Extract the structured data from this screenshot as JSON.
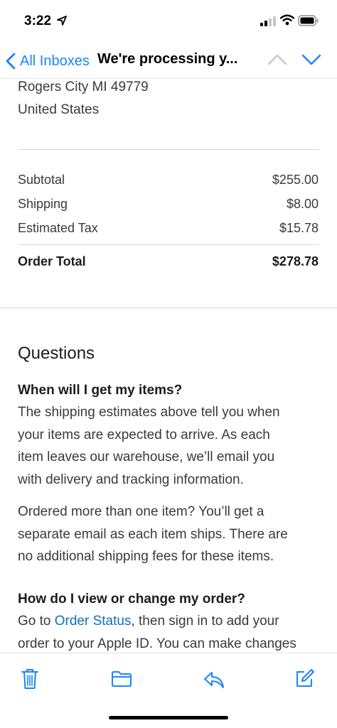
{
  "status_bar": {
    "time": "3:22"
  },
  "nav": {
    "back_label": "All Inboxes",
    "subject": "We're processing y..."
  },
  "address": {
    "line1": "Rogers City MI 49779",
    "line2": "United States"
  },
  "summary": {
    "rows": [
      {
        "label": "Subtotal",
        "value": "$255.00"
      },
      {
        "label": "Shipping",
        "value": "$8.00"
      },
      {
        "label": "Estimated Tax",
        "value": "$15.78"
      }
    ],
    "total_label": "Order Total",
    "total_value": "$278.78"
  },
  "questions": {
    "title": "Questions",
    "q1_title": "When will I get my items?",
    "q1_lines": [
      "The shipping estimates above tell you when",
      "your items are expected to arrive. As each",
      "item leaves our warehouse, we’ll email you",
      "with delivery and tracking information."
    ],
    "q1b_lines": [
      "Ordered more than one item? You’ll get a",
      "separate email as each item ships. There are",
      "no additional shipping fees for these items."
    ],
    "q2_title": "How do I view or change my order?",
    "q2_line1_prefix": "Go to ",
    "q2_link": "Order Status",
    "q2_line1_suffix": ", then sign in to add your",
    "q2_line2": "order to your Apple ID. You can make changes"
  },
  "toolbar": {
    "icons": [
      "trash-icon",
      "folder-icon",
      "reply-icon",
      "compose-icon"
    ]
  },
  "colors": {
    "accent": "#1a84ff",
    "link": "#0d6fbf",
    "text": "#3a3a3c"
  }
}
